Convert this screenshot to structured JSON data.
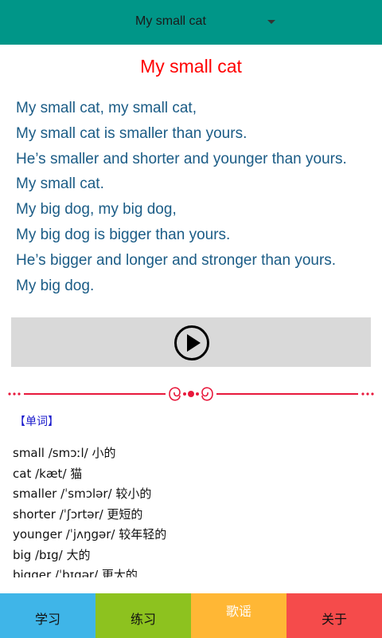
{
  "header": {
    "dropdown_label": "My small cat",
    "background_color": "#009688"
  },
  "song": {
    "title": "My small cat",
    "lines": [
      "My small cat, my small cat,",
      "My small cat is smaller than yours.",
      "He’s smaller and shorter and younger than yours.",
      "My small cat.",
      "My big dog, my big dog,",
      "My big dog is bigger than yours.",
      "He’s bigger and longer and stronger than yours.",
      "My big dog."
    ]
  },
  "player": {
    "icon": "play-icon"
  },
  "vocabulary": {
    "heading": "【单词】",
    "items": [
      "small  /smɔːl/  小的",
      " cat /kæt/  猫",
      " smaller  /ˈsmɔlər/  较小的",
      " shorter  /ˈʃɔrtər/  更短的",
      " younger /ˈjʌŋgər/  较年轻的",
      " big  /bɪg/  大的",
      " bigger  /ˈbɪgər/ 更大的"
    ]
  },
  "bottom_nav": {
    "tabs": [
      {
        "label": "学习",
        "color": "#3fb5e8"
      },
      {
        "label": "练习",
        "color": "#8dc21f"
      },
      {
        "label": "歌谣",
        "color": "#ffb735"
      },
      {
        "label": "关于",
        "color": "#f54b4b"
      }
    ]
  },
  "colors": {
    "title": "#ff0000",
    "lyrics": "#1b5c86",
    "divider": "#e8193c"
  }
}
